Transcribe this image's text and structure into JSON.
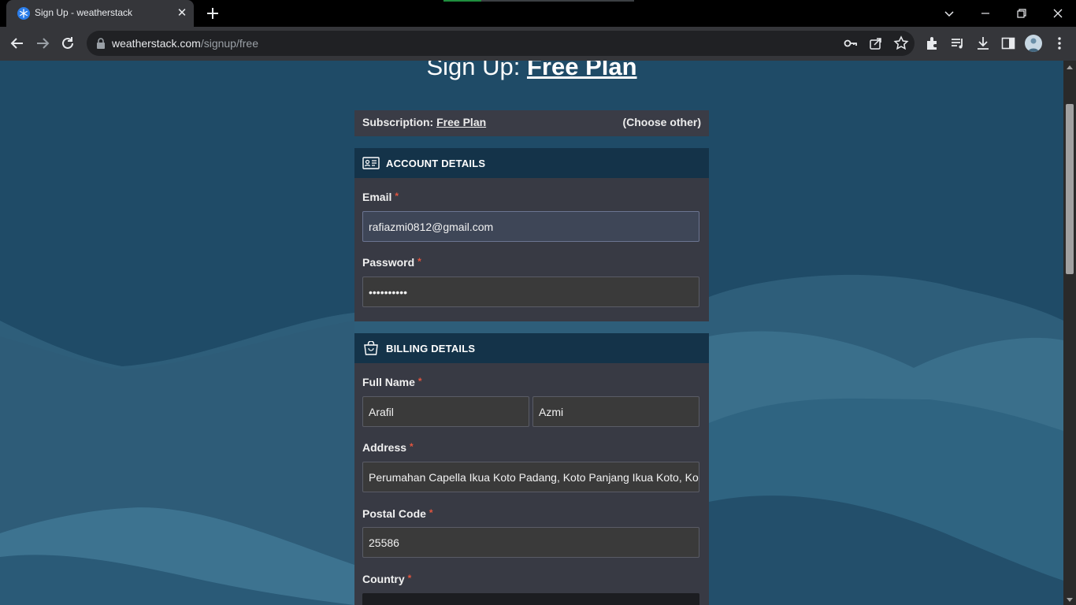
{
  "browser": {
    "tab_title": "Sign Up - weatherstack",
    "tab_close": "✕",
    "url_host": "weatherstack.com",
    "url_path": "/signup/free"
  },
  "page": {
    "heading_prefix": "Sign Up: ",
    "heading_link": "Free Plan",
    "subscription_label": "Subscription:",
    "subscription_plan": "Free Plan",
    "choose_other": "(Choose other)"
  },
  "account": {
    "title": "ACCOUNT DETAILS",
    "email_label": "Email",
    "email_value": "rafiazmi0812@gmail.com",
    "password_label": "Password",
    "password_value": "••••••••••"
  },
  "billing": {
    "title": "BILLING DETAILS",
    "fullname_label": "Full Name",
    "first_name": "Arafil",
    "last_name": "Azmi",
    "address_label": "Address",
    "address_value": "Perumahan Capella Ikua Koto Padang, Koto Panjang Ikua Koto, Ko",
    "postal_label": "Postal Code",
    "postal_value": "25586",
    "country_label": "Country"
  },
  "required_mark": "*",
  "colors": {
    "page_bg": "#1f4b67",
    "panel_header": "#143349",
    "panel_body": "#383a44",
    "required": "#e2553f"
  }
}
